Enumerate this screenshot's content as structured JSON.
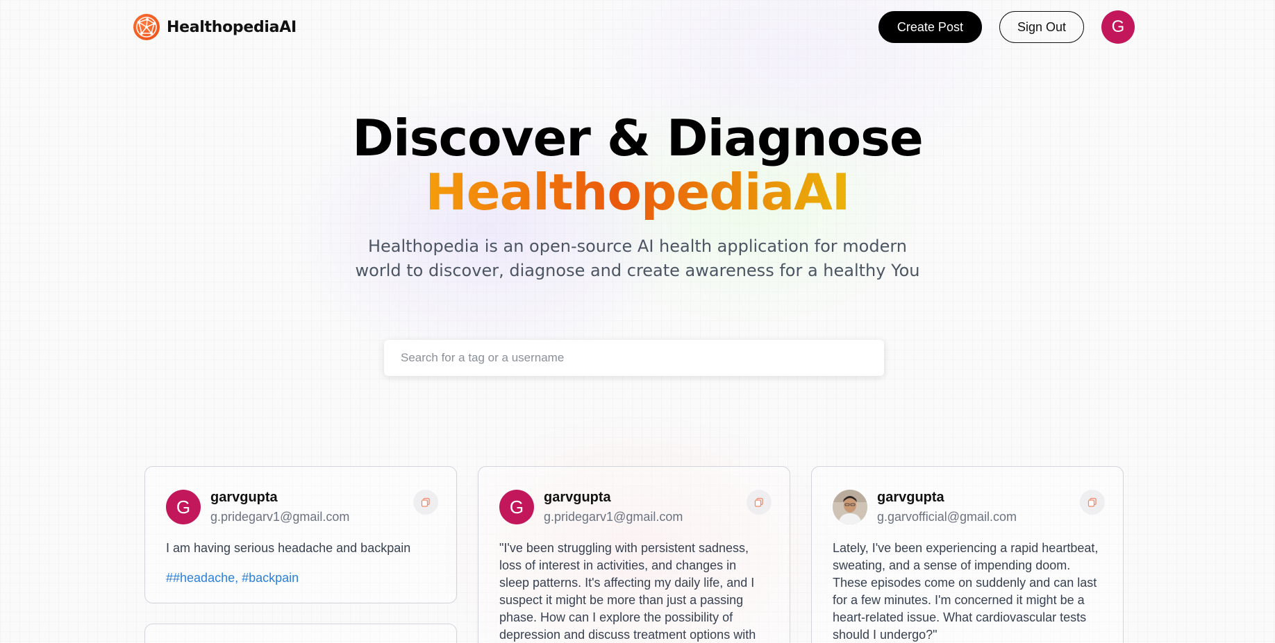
{
  "brand": {
    "name": "HealthopediaAI"
  },
  "nav": {
    "create_post": "Create Post",
    "sign_out": "Sign Out",
    "avatar_initial": "G"
  },
  "hero": {
    "title_line1": "Discover & Diagnose",
    "title_line2": "HealthopediaAI",
    "description": "Healthopedia is an open-source AI health application for modern world to discover, diagnose and create awareness for a healthy You"
  },
  "search": {
    "placeholder": "Search for a tag or a username",
    "value": ""
  },
  "posts": [
    {
      "avatar_initial": "G",
      "username": "garvgupta",
      "email": "g.pridegarv1@gmail.com",
      "text": "I am having serious headache and backpain",
      "tags": "##headache, #backpain"
    },
    {
      "avatar_initial": "G",
      "username": "garvgupta",
      "email": "g.pridegarv1@gmail.com",
      "text": "\"I've been struggling with persistent sadness, loss of interest in activities, and changes in sleep patterns. It's affecting my daily life, and I suspect it might be more than just a passing phase. How can I explore the possibility of depression and discuss treatment options with you?\""
    },
    {
      "username": "garvgupta",
      "email": "g.garvofficial@gmail.com",
      "text": "Lately, I've been experiencing a rapid heartbeat, sweating, and a sense of impending doom. These episodes come on suddenly and can last for a few minutes. I'm concerned it might be a heart-related issue. What cardiovascular tests should I undergo?\""
    }
  ],
  "colors": {
    "avatar_bg": "#c2185b",
    "tag_link": "#2b7fd8",
    "gradient_start": "#f59e0b",
    "gradient_mid": "#ea580c",
    "gradient_end": "#eab308"
  },
  "icons": {
    "logo": "globe-network-icon",
    "copy": "copy-icon"
  }
}
